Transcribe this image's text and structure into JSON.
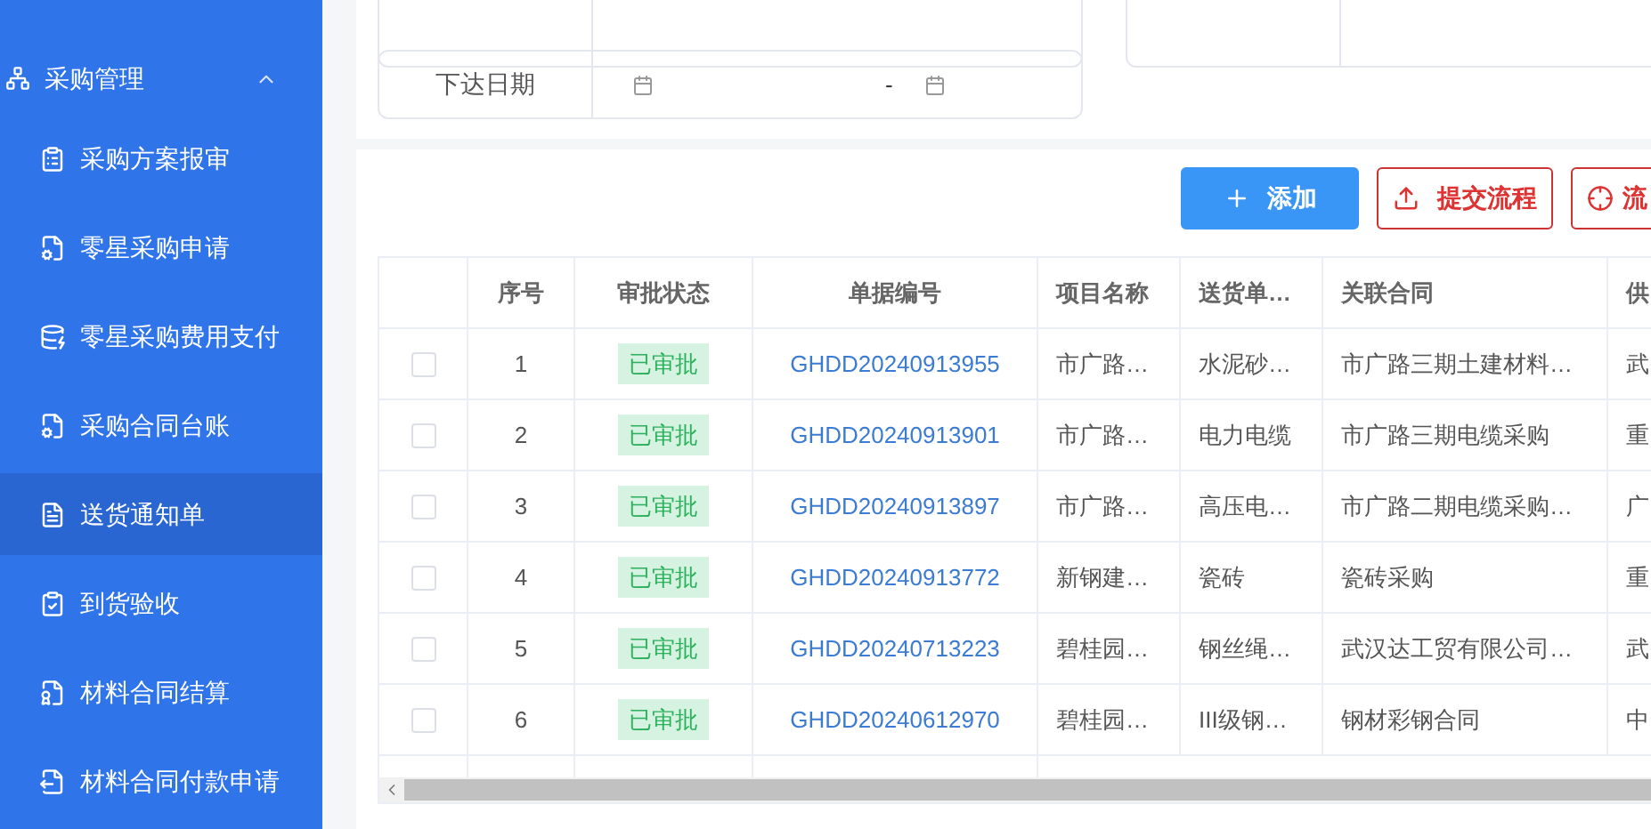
{
  "sidebar": {
    "group": {
      "label": "采购管理",
      "expanded": true
    },
    "items": [
      {
        "label": "采购方案报审",
        "selected": false
      },
      {
        "label": "零星采购申请",
        "selected": false
      },
      {
        "label": "零星采购费用支付",
        "selected": false
      },
      {
        "label": "采购合同台账",
        "selected": false
      },
      {
        "label": "送货通知单",
        "selected": true
      },
      {
        "label": "到货验收",
        "selected": false
      },
      {
        "label": "材料合同结算",
        "selected": false
      },
      {
        "label": "材料合同付款申请",
        "selected": false
      }
    ]
  },
  "filters": {
    "date": {
      "label": "下达日期",
      "separator": "-"
    }
  },
  "toolbar": [
    {
      "label": "添加",
      "kind": "primary"
    },
    {
      "label": "提交流程",
      "kind": "danger"
    },
    {
      "label": "流",
      "kind": "danger-crosshair"
    }
  ],
  "table": {
    "columns": [
      "序号",
      "审批状态",
      "单据编号",
      "项目名称",
      "送货单…",
      "关联合同",
      "供"
    ],
    "rows": [
      {
        "checked": false,
        "cells": [
          "1",
          "已审批",
          "GHDD20240913955",
          "市广路…",
          "水泥砂…",
          "市广路三期土建材料…",
          "武"
        ]
      },
      {
        "checked": false,
        "cells": [
          "2",
          "已审批",
          "GHDD20240913901",
          "市广路…",
          "电力电缆",
          "市广路三期电缆采购",
          "重"
        ]
      },
      {
        "checked": false,
        "cells": [
          "3",
          "已审批",
          "GHDD20240913897",
          "市广路…",
          "高压电…",
          "市广路二期电缆采购…",
          "广"
        ]
      },
      {
        "checked": false,
        "cells": [
          "4",
          "已审批",
          "GHDD20240913772",
          "新钢建…",
          "瓷砖",
          "瓷砖采购",
          "重"
        ]
      },
      {
        "checked": false,
        "cells": [
          "5",
          "已审批",
          "GHDD20240713223",
          "碧桂园…",
          "钢丝绳…",
          "武汉达工贸有限公司…",
          "武"
        ]
      },
      {
        "checked": false,
        "cells": [
          "6",
          "已审批",
          "GHDD20240612970",
          "碧桂园…",
          "III级钢…",
          "钢材彩钢合同",
          "中"
        ]
      }
    ]
  }
}
